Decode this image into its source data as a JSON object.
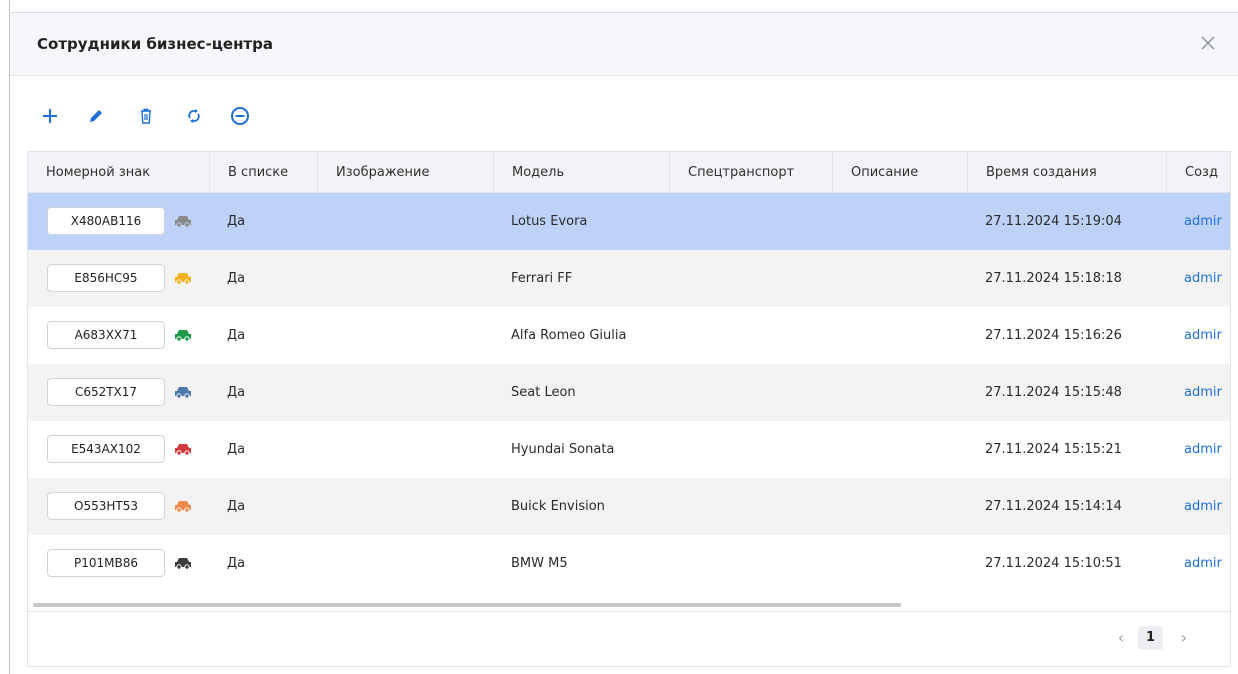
{
  "dialog": {
    "title": "Сотрудники бизнес-центра"
  },
  "toolbar": {
    "icons": [
      "plus-icon",
      "pencil-icon",
      "trash-icon",
      "refresh-icon",
      "minus-circle-icon"
    ],
    "accent": "#1f6fd6"
  },
  "table": {
    "columns": [
      "Номерной знак",
      "В списке",
      "Изображение",
      "Модель",
      "Спецтранспорт",
      "Описание",
      "Время создания",
      "Созд"
    ],
    "rows": [
      {
        "plate": "X480AB116",
        "car_color": "#8a8a8a",
        "in_list": "Да",
        "model": "Lotus Evora",
        "created": "27.11.2024 15:19:04",
        "creator": "admir",
        "selected": true
      },
      {
        "plate": "E856HC95",
        "car_color": "#f2b21b",
        "in_list": "Да",
        "model": "Ferrari FF",
        "created": "27.11.2024 15:18:18",
        "creator": "admir"
      },
      {
        "plate": "A683XX71",
        "car_color": "#1e9a4a",
        "in_list": "Да",
        "model": "Alfa Romeo Giulia",
        "created": "27.11.2024 15:16:26",
        "creator": "admir"
      },
      {
        "plate": "C652TX17",
        "car_color": "#4a78a8",
        "in_list": "Да",
        "model": "Seat Leon",
        "created": "27.11.2024 15:15:48",
        "creator": "admir"
      },
      {
        "plate": "E543AX102",
        "car_color": "#d23b3b",
        "in_list": "Да",
        "model": "Hyundai Sonata",
        "created": "27.11.2024 15:15:21",
        "creator": "admir"
      },
      {
        "plate": "O553HT53",
        "car_color": "#f08a4b",
        "in_list": "Да",
        "model": "Buick Envision",
        "created": "27.11.2024 15:14:14",
        "creator": "admir"
      },
      {
        "plate": "P101MB86",
        "car_color": "#3d3d3d",
        "in_list": "Да",
        "model": "BMW M5",
        "created": "27.11.2024 15:10:51",
        "creator": "admir"
      }
    ]
  },
  "pagination": {
    "prev": "‹",
    "current": "1",
    "next": "›"
  },
  "colors": {
    "selected_row": "#bed2f7",
    "alt_row": "#f3f3f4",
    "link": "#1f6fd6"
  }
}
